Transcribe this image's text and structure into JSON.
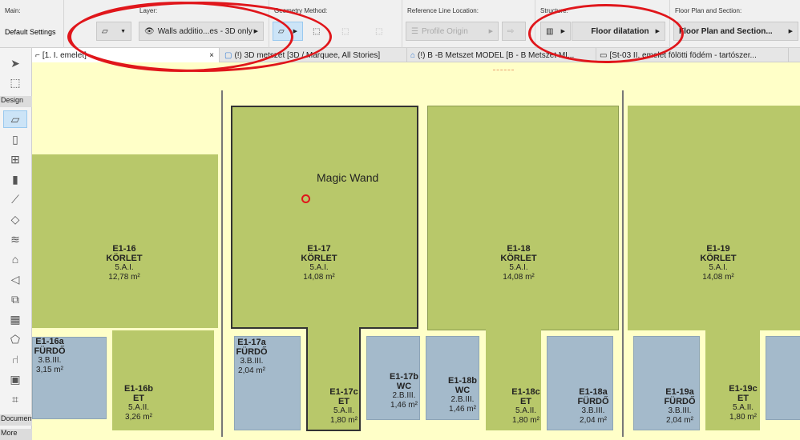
{
  "infobox": {
    "main": {
      "label": "Main:",
      "value": "Default Settings"
    },
    "layer": {
      "label": "Layer:",
      "value": "Walls additio...es - 3D only"
    },
    "geometry": {
      "label": "Geometry Method:"
    },
    "refline": {
      "label": "Reference Line Location:",
      "value": "Profile Origin"
    },
    "structure": {
      "label": "Structure:",
      "value": "Floor dilatation"
    },
    "floorplan": {
      "label": "Floor Plan and Section:",
      "value": "Floor Plan and Section..."
    }
  },
  "tabs": [
    {
      "label": "[1. I. emelet]",
      "close": "×"
    },
    {
      "label": "(!) 3D metszet [3D / Marquee, All Stories]"
    },
    {
      "label": "(!) B -B Metszet MODEL [B - B Metszet MI..."
    },
    {
      "label": "[St-03 II. emelet fölötti födém - tartószer..."
    }
  ],
  "toolbox": {
    "design": "Design",
    "document": "Document",
    "more": "More"
  },
  "annotation": {
    "magic_wand": "Magic Wand"
  },
  "rooms": [
    {
      "id": "E1-16",
      "name": "KÖRLET",
      "code": "5.A.I.",
      "area": "12,78 m²"
    },
    {
      "id": "E1-17",
      "name": "KÖRLET",
      "code": "5.A.I.",
      "area": "14,08 m²"
    },
    {
      "id": "E1-18",
      "name": "KÖRLET",
      "code": "5.A.I.",
      "area": "14,08 m²"
    },
    {
      "id": "E1-19",
      "name": "KÖRLET",
      "code": "5.A.I.",
      "area": "14,08 m²"
    },
    {
      "id": "E1-16a",
      "name": "FÜRDŐ",
      "code": "3.B.III.",
      "area": "3,15 m²"
    },
    {
      "id": "E1-16b",
      "name": "ET",
      "code": "5.A.II.",
      "area": "3,26 m²"
    },
    {
      "id": "E1-17a",
      "name": "FÜRDŐ",
      "code": "3.B.III.",
      "area": "2,04 m²"
    },
    {
      "id": "E1-17c",
      "name": "ET",
      "code": "5.A.II.",
      "area": "1,80 m²"
    },
    {
      "id": "E1-17b",
      "name": "WC",
      "code": "2.B.III.",
      "area": "1,46 m²"
    },
    {
      "id": "E1-18b",
      "name": "WC",
      "code": "2.B.III.",
      "area": "1,46 m²"
    },
    {
      "id": "E1-18c",
      "name": "ET",
      "code": "5.A.II.",
      "area": "1,80 m²"
    },
    {
      "id": "E1-18a",
      "name": "FÜRDŐ",
      "code": "3.B.III.",
      "area": "2,04 m²"
    },
    {
      "id": "E1-19a",
      "name": "FÜRDŐ",
      "code": "3.B.III.",
      "area": "2,04 m²"
    },
    {
      "id": "E1-19c",
      "name": "ET",
      "code": "5.A.II.",
      "area": "1,80 m²"
    }
  ]
}
